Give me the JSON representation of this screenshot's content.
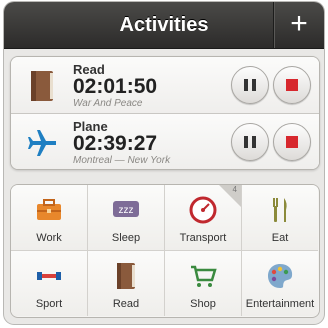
{
  "header": {
    "title": "Activities",
    "add_icon": "plus-icon",
    "add_label": "+"
  },
  "timers": [
    {
      "label": "Read",
      "time": "02:01:50",
      "subtitle": "War And Peace",
      "icon": "book-icon",
      "color": "#8a5a3c"
    },
    {
      "label": "Plane",
      "time": "02:39:27",
      "subtitle": "Montreal — New York",
      "icon": "plane-icon",
      "color": "#1f7fc2"
    }
  ],
  "categories": [
    {
      "label": "Work",
      "icon": "toolbox-icon"
    },
    {
      "label": "Sleep",
      "icon": "zzz-icon"
    },
    {
      "label": "Transport",
      "icon": "speedometer-icon",
      "badge": "4"
    },
    {
      "label": "Eat",
      "icon": "fork-knife-icon"
    },
    {
      "label": "Sport",
      "icon": "dumbbell-icon"
    },
    {
      "label": "Read",
      "icon": "book-icon"
    },
    {
      "label": "Shop",
      "icon": "cart-icon"
    },
    {
      "label": "Entertainment",
      "icon": "palette-icon"
    }
  ],
  "colors": {
    "stop": "#d7272d",
    "header": "#3a3938"
  }
}
